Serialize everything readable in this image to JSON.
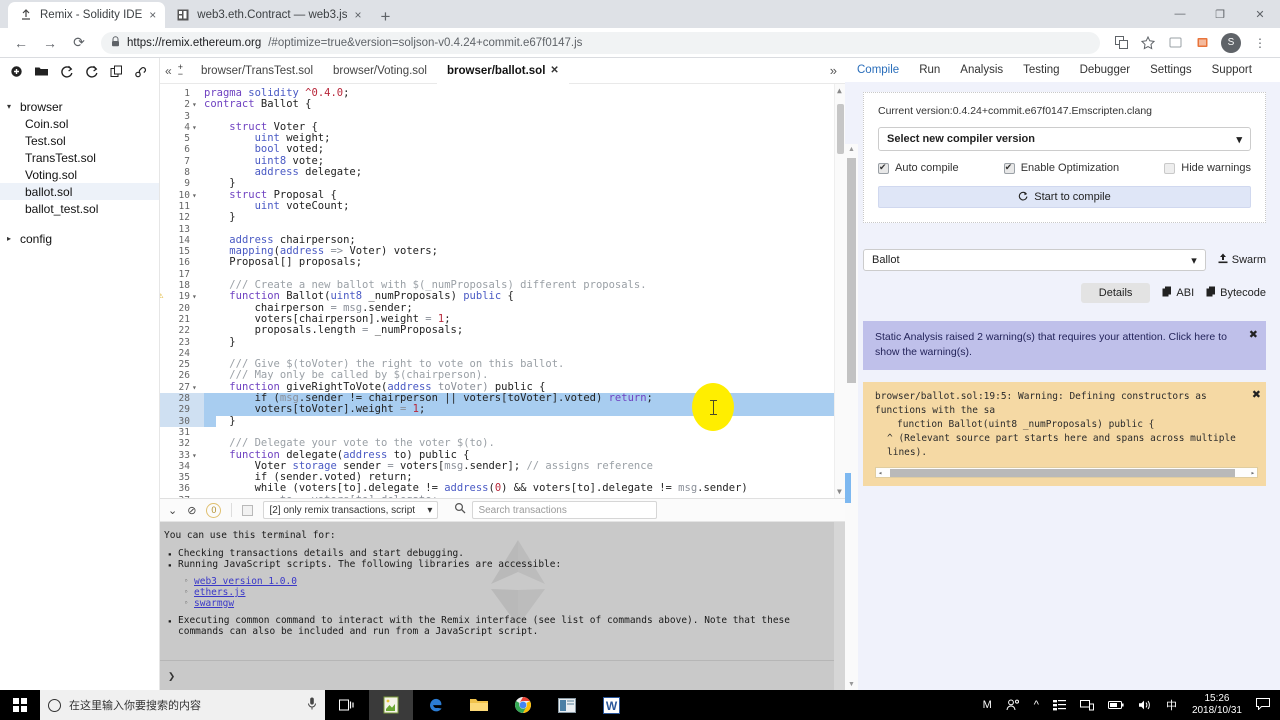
{
  "browser": {
    "tabs": [
      {
        "title": "Remix - Solidity IDE",
        "favicon": "remix-icon",
        "active": true
      },
      {
        "title": "web3.eth.Contract — web3.js",
        "favicon": "web3-icon",
        "active": false
      }
    ],
    "new_tab_label": "+",
    "close_glyph": "×",
    "window_controls": {
      "minimize": "—",
      "maximize": "❐",
      "close": "✕"
    },
    "nav": {
      "back": "←",
      "forward": "→",
      "reload": "⟳"
    },
    "url_domain": "https://remix.ethereum.org",
    "url_rest": "/#optimize=true&version=soljson-v0.4.24+commit.e67f0147.js",
    "lock_icon": "🔒",
    "toolbar_icons": [
      "translate-icon",
      "bookmark-star-icon",
      "extension-icon",
      "puzzle-icon"
    ],
    "avatar_letter": "S",
    "menu_glyph": "⋮"
  },
  "filepanel": {
    "toolbar_icons": [
      {
        "name": "create-file-icon",
        "glyph": "⊕"
      },
      {
        "name": "open-folder-icon",
        "glyph": "🗁"
      },
      {
        "name": "publish-gist-icon",
        "glyph": "⭮"
      },
      {
        "name": "copy-gist-icon",
        "glyph": "⭯"
      },
      {
        "name": "copy-instance-icon",
        "glyph": "⧉"
      },
      {
        "name": "connect-localhost-icon",
        "glyph": "🔗"
      }
    ],
    "groups": [
      {
        "name": "browser",
        "caret": "▾",
        "expanded": true,
        "files": [
          "Coin.sol",
          "Test.sol",
          "TransTest.sol",
          "Voting.sol",
          "ballot.sol",
          "ballot_test.sol"
        ],
        "selected": "ballot.sol"
      },
      {
        "name": "config",
        "caret": "▸",
        "expanded": false,
        "files": []
      }
    ]
  },
  "editor": {
    "collapse_glyph": "«",
    "expand_glyph": "»",
    "zoom_in": "+",
    "zoom_out": "−",
    "tabs": [
      {
        "label": "browser/TransTest.sol",
        "active": false
      },
      {
        "label": "browser/Voting.sol",
        "active": false
      },
      {
        "label": "browser/ballot.sol",
        "active": true,
        "close": "✕"
      }
    ],
    "warning_line": 19,
    "warning_glyph": "⚠",
    "selected_lines": [
      28,
      29,
      30
    ],
    "folded_lines": [
      2,
      4,
      10,
      19,
      27,
      33
    ],
    "lines": [
      {
        "n": 1,
        "tokens": [
          {
            "t": "pragma ",
            "c": "kw"
          },
          {
            "t": "solidity ",
            "c": "typ"
          },
          {
            "t": "^0.4.0",
            "c": "num"
          },
          {
            "t": ";",
            "c": "pln"
          }
        ]
      },
      {
        "n": 2,
        "tokens": [
          {
            "t": "contract ",
            "c": "kw"
          },
          {
            "t": "Ballot",
            "c": "pln"
          },
          {
            "t": " {",
            "c": "pln"
          }
        ]
      },
      {
        "n": 3,
        "tokens": []
      },
      {
        "n": 4,
        "indent": 4,
        "tokens": [
          {
            "t": "struct ",
            "c": "kw"
          },
          {
            "t": "Voter",
            "c": "pln"
          },
          {
            "t": " {",
            "c": "pln"
          }
        ]
      },
      {
        "n": 5,
        "indent": 8,
        "tokens": [
          {
            "t": "uint ",
            "c": "typ"
          },
          {
            "t": "weight;",
            "c": "pln"
          }
        ]
      },
      {
        "n": 6,
        "indent": 8,
        "tokens": [
          {
            "t": "bool ",
            "c": "typ"
          },
          {
            "t": "voted;",
            "c": "pln"
          }
        ]
      },
      {
        "n": 7,
        "indent": 8,
        "tokens": [
          {
            "t": "uint8 ",
            "c": "typ"
          },
          {
            "t": "vote;",
            "c": "pln"
          }
        ]
      },
      {
        "n": 8,
        "indent": 8,
        "tokens": [
          {
            "t": "address ",
            "c": "typ"
          },
          {
            "t": "delegate;",
            "c": "pln"
          }
        ]
      },
      {
        "n": 9,
        "indent": 4,
        "tokens": [
          {
            "t": "}",
            "c": "pln"
          }
        ]
      },
      {
        "n": 10,
        "indent": 4,
        "tokens": [
          {
            "t": "struct ",
            "c": "kw"
          },
          {
            "t": "Proposal",
            "c": "pln"
          },
          {
            "t": " {",
            "c": "pln"
          }
        ]
      },
      {
        "n": 11,
        "indent": 8,
        "tokens": [
          {
            "t": "uint ",
            "c": "typ"
          },
          {
            "t": "voteCount;",
            "c": "pln"
          }
        ]
      },
      {
        "n": 12,
        "indent": 4,
        "tokens": [
          {
            "t": "}",
            "c": "pln"
          }
        ]
      },
      {
        "n": 13,
        "tokens": []
      },
      {
        "n": 14,
        "indent": 4,
        "tokens": [
          {
            "t": "address ",
            "c": "typ"
          },
          {
            "t": "chairperson;",
            "c": "pln"
          }
        ]
      },
      {
        "n": 15,
        "indent": 4,
        "tokens": [
          {
            "t": "mapping",
            "c": "typ"
          },
          {
            "t": "(",
            "c": "pln"
          },
          {
            "t": "address ",
            "c": "typ"
          },
          {
            "t": "=> ",
            "c": "dim"
          },
          {
            "t": "Voter) voters;",
            "c": "pln"
          }
        ]
      },
      {
        "n": 16,
        "indent": 4,
        "tokens": [
          {
            "t": "Proposal[] proposals;",
            "c": "pln"
          }
        ]
      },
      {
        "n": 17,
        "tokens": []
      },
      {
        "n": 18,
        "indent": 4,
        "tokens": [
          {
            "t": "/// Create a new ballot with $(_numProposals) different proposals.",
            "c": "cmt"
          }
        ]
      },
      {
        "n": 19,
        "indent": 4,
        "tokens": [
          {
            "t": "function ",
            "c": "kw"
          },
          {
            "t": "Ballot",
            "c": "pln"
          },
          {
            "t": "(",
            "c": "pln"
          },
          {
            "t": "uint8 ",
            "c": "typ"
          },
          {
            "t": "_numProposals) ",
            "c": "pln"
          },
          {
            "t": "public",
            "c": "typ"
          },
          {
            "t": " {",
            "c": "pln"
          }
        ]
      },
      {
        "n": 20,
        "indent": 8,
        "tokens": [
          {
            "t": "chairperson ",
            "c": "pln"
          },
          {
            "t": "= ",
            "c": "dim"
          },
          {
            "t": "msg",
            "c": "dim"
          },
          {
            "t": ".sender;",
            "c": "pln"
          }
        ]
      },
      {
        "n": 21,
        "indent": 8,
        "tokens": [
          {
            "t": "voters[chairperson].weight ",
            "c": "pln"
          },
          {
            "t": "= ",
            "c": "dim"
          },
          {
            "t": "1",
            "c": "num"
          },
          {
            "t": ";",
            "c": "pln"
          }
        ]
      },
      {
        "n": 22,
        "indent": 8,
        "tokens": [
          {
            "t": "proposals.length ",
            "c": "pln"
          },
          {
            "t": "= ",
            "c": "dim"
          },
          {
            "t": "_numProposals;",
            "c": "pln"
          }
        ]
      },
      {
        "n": 23,
        "indent": 4,
        "tokens": [
          {
            "t": "}",
            "c": "pln"
          }
        ]
      },
      {
        "n": 24,
        "tokens": []
      },
      {
        "n": 25,
        "indent": 4,
        "tokens": [
          {
            "t": "/// Give $(toVoter) the right to vote on this ballot.",
            "c": "cmt"
          }
        ]
      },
      {
        "n": 26,
        "indent": 4,
        "tokens": [
          {
            "t": "/// May only be called by $(chairperson).",
            "c": "cmt"
          }
        ]
      },
      {
        "n": 27,
        "indent": 4,
        "tokens": [
          {
            "t": "function ",
            "c": "kw"
          },
          {
            "t": "giveRightToVote",
            "c": "pln"
          },
          {
            "t": "(",
            "c": "pln"
          },
          {
            "t": "address ",
            "c": "typ"
          },
          {
            "t": "toVoter) ",
            "c": "dim"
          },
          {
            "t": "public",
            "c": "pln"
          },
          {
            "t": " {",
            "c": "pln"
          }
        ]
      },
      {
        "n": 28,
        "indent": 8,
        "tokens": [
          {
            "t": "if (",
            "c": "pln"
          },
          {
            "t": "msg",
            "c": "dim"
          },
          {
            "t": ".sender != chairperson || voters[toVoter].voted) ",
            "c": "pln"
          },
          {
            "t": "return",
            "c": "kw"
          },
          {
            "t": ";",
            "c": "pln"
          }
        ]
      },
      {
        "n": 29,
        "indent": 8,
        "tokens": [
          {
            "t": "voters[toVoter].weight ",
            "c": "pln"
          },
          {
            "t": "= ",
            "c": "dim"
          },
          {
            "t": "1",
            "c": "num"
          },
          {
            "t": ";",
            "c": "pln"
          }
        ]
      },
      {
        "n": 30,
        "indent": 4,
        "tokens": [
          {
            "t": "}",
            "c": "pln"
          }
        ]
      },
      {
        "n": 31,
        "tokens": []
      },
      {
        "n": 32,
        "indent": 4,
        "tokens": [
          {
            "t": "/// Delegate your vote to the voter $(to).",
            "c": "cmt"
          }
        ]
      },
      {
        "n": 33,
        "indent": 4,
        "tokens": [
          {
            "t": "function ",
            "c": "kw"
          },
          {
            "t": "delegate",
            "c": "pln"
          },
          {
            "t": "(",
            "c": "pln"
          },
          {
            "t": "address ",
            "c": "typ"
          },
          {
            "t": "to) ",
            "c": "pln"
          },
          {
            "t": "public",
            "c": "pln"
          },
          {
            "t": " {",
            "c": "pln"
          }
        ]
      },
      {
        "n": 34,
        "indent": 8,
        "tokens": [
          {
            "t": "Voter ",
            "c": "pln"
          },
          {
            "t": "storage ",
            "c": "typ"
          },
          {
            "t": "sender ",
            "c": "pln"
          },
          {
            "t": "= ",
            "c": "dim"
          },
          {
            "t": "voters[",
            "c": "pln"
          },
          {
            "t": "msg",
            "c": "dim"
          },
          {
            "t": ".sender]; ",
            "c": "pln"
          },
          {
            "t": "// assigns reference",
            "c": "cmt"
          }
        ]
      },
      {
        "n": 35,
        "indent": 8,
        "tokens": [
          {
            "t": "if (sender.voted) return;",
            "c": "pln"
          }
        ]
      },
      {
        "n": 36,
        "indent": 8,
        "tokens": [
          {
            "t": "while (voters[to].delegate != ",
            "c": "pln"
          },
          {
            "t": "address",
            "c": "typ"
          },
          {
            "t": "(",
            "c": "pln"
          },
          {
            "t": "0",
            "c": "num"
          },
          {
            "t": ") && voters[to].delegate != ",
            "c": "pln"
          },
          {
            "t": "msg",
            "c": "dim"
          },
          {
            "t": ".sender)",
            "c": "pln"
          }
        ]
      },
      {
        "n": 37,
        "indent": 12,
        "tokens": [
          {
            "t": "to = voters[to].delegate;",
            "c": "dim"
          }
        ]
      }
    ]
  },
  "terminal": {
    "toolbar": {
      "collapse_icon": "⌄",
      "clear_icon": "⊘",
      "pending_count": "0",
      "checkbox_checked": false,
      "filter_label": "[2] only remix transactions, script",
      "filter_caret": "▾",
      "search_icon": "search-icon",
      "search_placeholder": "Search transactions",
      "search_value": ""
    },
    "intro": "You can use this terminal for:",
    "bullets": [
      "Checking transactions details and start debugging.",
      "Running JavaScript scripts. The following libraries are accessible:"
    ],
    "links": [
      "web3 version 1.0.0",
      "ethers.js",
      "swarmgw"
    ],
    "footer": "Executing common command to interact with the Remix interface (see list of commands above). Note that these commands can also be included and run from a JavaScript script.",
    "prompt": "❯"
  },
  "rightpanel": {
    "tabs": [
      {
        "label": "Compile",
        "active": true
      },
      {
        "label": "Run",
        "active": false
      },
      {
        "label": "Analysis",
        "active": false
      },
      {
        "label": "Testing",
        "active": false
      },
      {
        "label": "Debugger",
        "active": false
      },
      {
        "label": "Settings",
        "active": false
      },
      {
        "label": "Support",
        "active": false
      }
    ],
    "current_version": "Current version:0.4.24+commit.e67f0147.Emscripten.clang",
    "version_select": {
      "label": "Select new compiler version",
      "caret": "▾"
    },
    "checkboxes": [
      {
        "label": "Auto compile",
        "checked": true
      },
      {
        "label": "Enable Optimization",
        "checked": true
      },
      {
        "label": "Hide warnings",
        "checked": false
      }
    ],
    "compile_button": {
      "label": "Start to compile",
      "icon": "refresh-icon"
    },
    "contract_select": {
      "value": "Ballot",
      "caret": "▾"
    },
    "swarm_button": {
      "label": "Swarm",
      "icon": "upload-icon"
    },
    "detail_buttons": [
      {
        "label": "Details",
        "icon": null
      },
      {
        "label": "ABI",
        "icon": "copy-icon"
      },
      {
        "label": "Bytecode",
        "icon": "copy-icon"
      }
    ],
    "alert_static": {
      "text": "Static Analysis raised 2 warning(s) that requires your attention. Click here to show the warning(s).",
      "close": "✖"
    },
    "alert_warning": {
      "line1": "browser/ballot.sol:19:5: Warning: Defining constructors as functions with the sa",
      "line2": "function Ballot(uint8 _numProposals) public {",
      "line3": "^ (Relevant source part starts here and spans across multiple lines).",
      "close": "✖",
      "scroll_left": "◂",
      "scroll_right": "▸"
    }
  },
  "taskbar": {
    "start_icon": "windows-logo-icon",
    "search_placeholder": "在这里输入你要搜索的内容",
    "mic_icon": "🎙",
    "apps": [
      {
        "name": "task-view-icon",
        "glyph": "☰",
        "active": false
      },
      {
        "name": "notepad-app-icon",
        "glyph": "🗒",
        "active": true
      },
      {
        "name": "edge-browser-icon",
        "glyph": "e",
        "active": false
      },
      {
        "name": "file-explorer-icon",
        "glyph": "🗂",
        "active": false
      },
      {
        "name": "chrome-browser-icon",
        "glyph": "◉",
        "active": false
      },
      {
        "name": "app-icon",
        "glyph": "▤",
        "active": false
      },
      {
        "name": "word-app-icon",
        "glyph": "W",
        "active": false
      }
    ],
    "tray_icons": [
      "M",
      "people-icon",
      "chevron-up-icon",
      "list-icon",
      "network-icon",
      "battery-icon",
      "volume-icon"
    ],
    "ime_label": "中",
    "time": "15:26",
    "date": "2018/10/31",
    "notification_icon": "notification-icon"
  },
  "colors": {
    "chrome_titlebar": "#dee1e6",
    "selection": "#a8cdf0",
    "alert_purple": "#bfc0ea",
    "alert_orange": "#f5d9a4",
    "accent_blue": "#2a6ebb",
    "cursor_yellow": "#ffee00",
    "terminal_bg": "#c9c9c9"
  }
}
